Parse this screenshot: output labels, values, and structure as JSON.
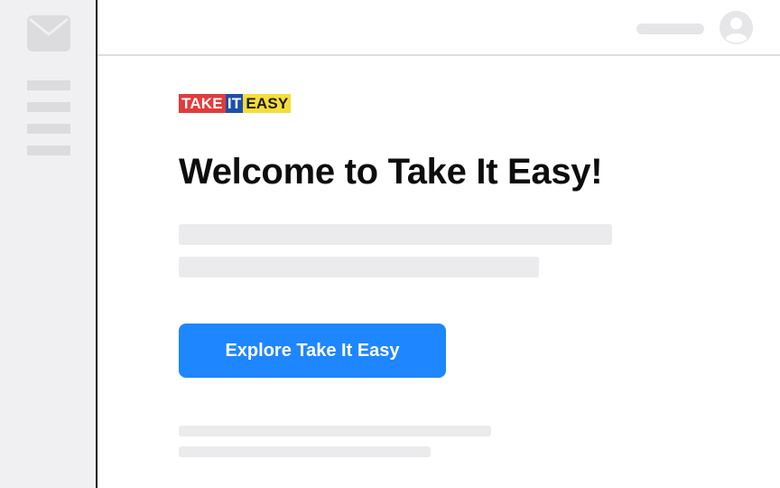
{
  "sidebar": {
    "icon": "mail-icon",
    "menu_items": 4
  },
  "topbar": {
    "avatar_icon": "user-avatar-icon"
  },
  "logo": {
    "part1": "TAKE",
    "part2": "IT",
    "part3": "EASY",
    "colors": {
      "take": "#e23b3b",
      "it": "#1d4fa8",
      "easy": "#f5dd3c"
    }
  },
  "main": {
    "title": "Welcome to Take It Easy!",
    "cta_label": "Explore Take It Easy"
  },
  "colors": {
    "accent": "#1e86ff",
    "placeholder": "#ebebed",
    "sidebar_bg": "#f0f0f2"
  }
}
